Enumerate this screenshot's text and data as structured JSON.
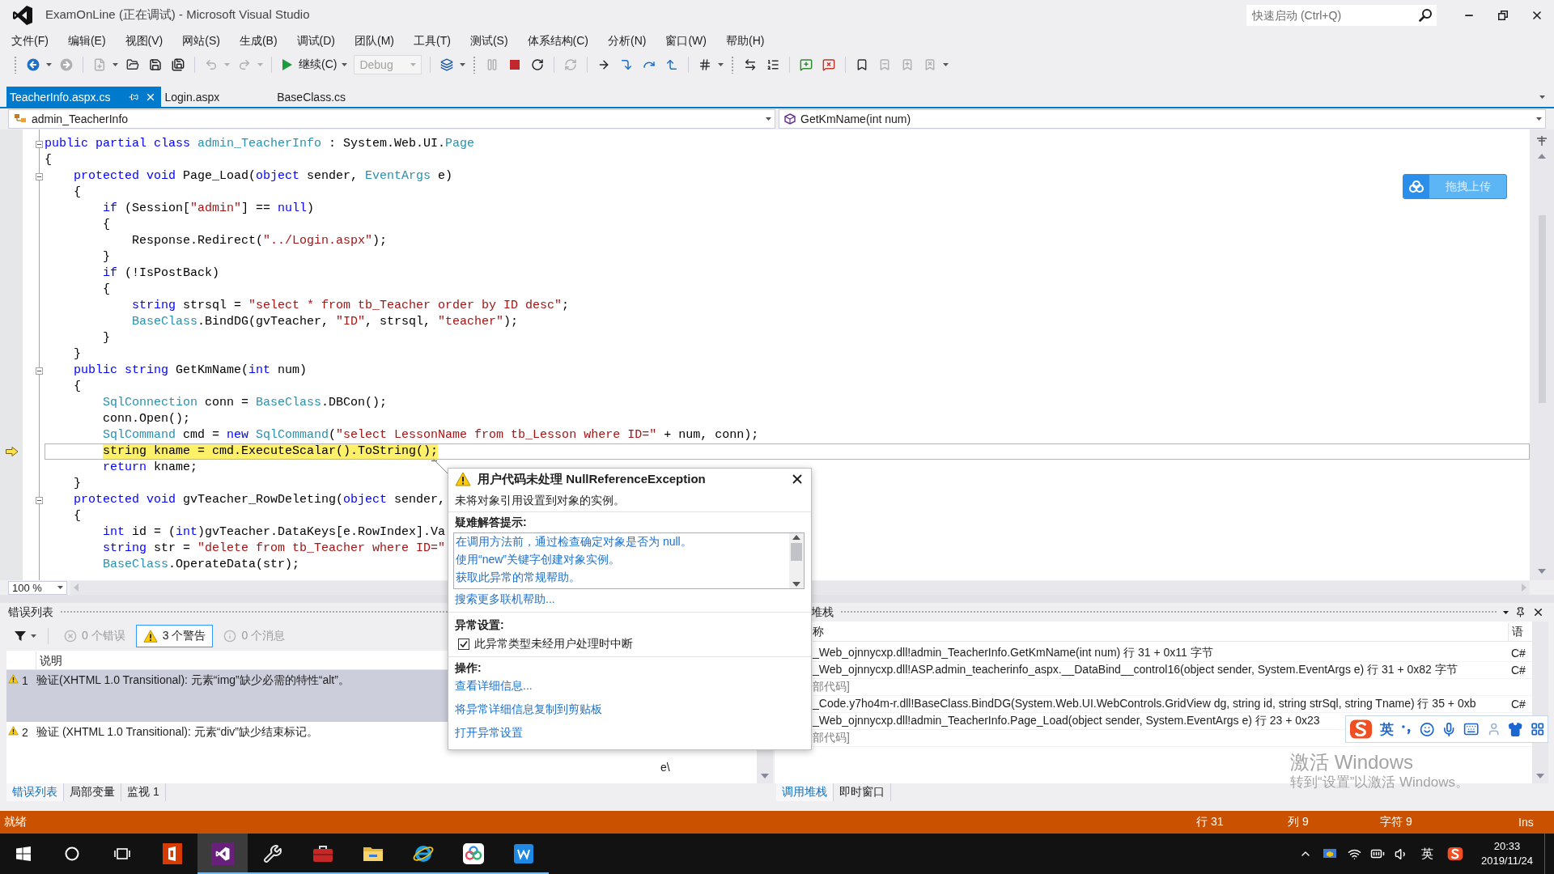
{
  "window": {
    "title": "ExamOnLine (正在调试) - Microsoft Visual Studio",
    "quick_launch": {
      "placeholder": "快速启动 (Ctrl+Q)"
    }
  },
  "menu": [
    "文件(F)",
    "编辑(E)",
    "视图(V)",
    "网站(S)",
    "生成(B)",
    "调试(D)",
    "团队(M)",
    "工具(T)",
    "测试(S)",
    "体系结构(C)",
    "分析(N)",
    "窗口(W)",
    "帮助(H)"
  ],
  "toolbar": [
    {
      "kind": "gripper"
    },
    {
      "kind": "back",
      "disabled": false
    },
    {
      "kind": "caret",
      "disabled": false
    },
    {
      "kind": "forward",
      "disabled": true
    },
    {
      "kind": "separator"
    },
    {
      "kind": "new_project",
      "disabled": true
    },
    {
      "kind": "caret",
      "disabled": false
    },
    {
      "kind": "open",
      "disabled": false
    },
    {
      "kind": "save",
      "disabled": false
    },
    {
      "kind": "save_all",
      "disabled": false
    },
    {
      "kind": "separator"
    },
    {
      "kind": "undo",
      "disabled": true
    },
    {
      "kind": "caret",
      "disabled": true
    },
    {
      "kind": "redo",
      "disabled": true
    },
    {
      "kind": "caret",
      "disabled": true
    },
    {
      "kind": "separator"
    },
    {
      "kind": "continue",
      "label": "继续(C)",
      "disabled": false
    },
    {
      "kind": "caret",
      "disabled": false
    },
    {
      "kind": "configuration",
      "value": "Debug",
      "disabled": true
    },
    {
      "kind": "separator"
    },
    {
      "kind": "attach",
      "disabled": false
    },
    {
      "kind": "caret",
      "disabled": false
    },
    {
      "kind": "gripper"
    },
    {
      "kind": "pause",
      "disabled": true
    },
    {
      "kind": "stop",
      "disabled": false
    },
    {
      "kind": "restart",
      "disabled": false
    },
    {
      "kind": "separator"
    },
    {
      "kind": "refresh",
      "disabled": true
    },
    {
      "kind": "separator"
    },
    {
      "kind": "show_next",
      "disabled": false
    },
    {
      "kind": "step_into",
      "disabled": false
    },
    {
      "kind": "step_over",
      "disabled": false
    },
    {
      "kind": "step_out",
      "disabled": false
    },
    {
      "kind": "separator"
    },
    {
      "kind": "hex",
      "disabled": false
    },
    {
      "kind": "caret",
      "disabled": false
    },
    {
      "kind": "gripper"
    },
    {
      "kind": "threads",
      "disabled": false
    },
    {
      "kind": "stack",
      "disabled": false
    },
    {
      "kind": "separator"
    },
    {
      "kind": "comment_add",
      "disabled": false
    },
    {
      "kind": "comment_remove",
      "disabled": false
    },
    {
      "kind": "separator"
    },
    {
      "kind": "bookmark",
      "disabled": false
    },
    {
      "kind": "bookmark_prev",
      "disabled": true
    },
    {
      "kind": "bookmark_next",
      "disabled": true
    },
    {
      "kind": "bookmark_clear",
      "disabled": true
    },
    {
      "kind": "caret",
      "disabled": false
    }
  ],
  "tabs": [
    {
      "label": "TeacherInfo.aspx.cs",
      "selected": true
    },
    {
      "label": "Login.aspx",
      "selected": false
    },
    {
      "label": "BaseClass.cs",
      "selected": false
    }
  ],
  "navigation": {
    "type": "admin_TeacherInfo",
    "member": "GetKmName(int num)"
  },
  "editor": {
    "zoom": "100 %",
    "lines": [
      {
        "expanded": true,
        "tokens": [
          {
            "kind": "keyword",
            "text": "public partial class "
          },
          {
            "kind": "type",
            "text": "admin_TeacherInfo"
          },
          {
            "kind": "plain",
            "text": " : System.Web.UI."
          },
          {
            "kind": "type",
            "text": "Page"
          }
        ]
      },
      {
        "tokens": [
          {
            "kind": "plain",
            "text": "{"
          }
        ],
        "children": [
          {
            "expanded": true,
            "tokens": [
              {
                "kind": "keyword",
                "text": "protected void"
              },
              {
                "kind": "plain",
                "text": " Page_Load("
              },
              {
                "kind": "keyword",
                "text": "object"
              },
              {
                "kind": "plain",
                "text": " sender, "
              },
              {
                "kind": "type",
                "text": "EventArgs"
              },
              {
                "kind": "plain",
                "text": " e)"
              }
            ]
          },
          {
            "tokens": [
              {
                "kind": "plain",
                "text": "{"
              }
            ],
            "children": [
              {
                "tokens": [
                  {
                    "kind": "keyword",
                    "text": "if"
                  },
                  {
                    "kind": "plain",
                    "text": " (Session["
                  },
                  {
                    "kind": "string",
                    "text": "\"admin\""
                  },
                  {
                    "kind": "plain",
                    "text": "] == "
                  },
                  {
                    "kind": "keyword",
                    "text": "null"
                  },
                  {
                    "kind": "plain",
                    "text": ")"
                  }
                ]
              },
              {
                "tokens": [
                  {
                    "kind": "plain",
                    "text": "{"
                  }
                ],
                "children": [
                  {
                    "tokens": [
                      {
                        "kind": "plain",
                        "text": "Response.Redirect("
                      },
                      {
                        "kind": "string",
                        "text": "\"../Login.aspx\""
                      },
                      {
                        "kind": "plain",
                        "text": ");"
                      }
                    ]
                  }
                ]
              },
              {
                "tokens": [
                  {
                    "kind": "plain",
                    "text": "}"
                  }
                ]
              },
              {
                "tokens": [
                  {
                    "kind": "keyword",
                    "text": "if"
                  },
                  {
                    "kind": "plain",
                    "text": " (!IsPostBack)"
                  }
                ]
              },
              {
                "tokens": [
                  {
                    "kind": "plain",
                    "text": "{"
                  }
                ],
                "children": [
                  {
                    "tokens": [
                      {
                        "kind": "keyword",
                        "text": "string"
                      },
                      {
                        "kind": "plain",
                        "text": " strsql = "
                      },
                      {
                        "kind": "string",
                        "text": "\"select * from tb_Teacher order by ID desc\""
                      },
                      {
                        "kind": "plain",
                        "text": ";"
                      }
                    ]
                  },
                  {
                    "tokens": [
                      {
                        "kind": "type",
                        "text": "BaseClass"
                      },
                      {
                        "kind": "plain",
                        "text": ".BindDG(gvTeacher, "
                      },
                      {
                        "kind": "string",
                        "text": "\"ID\""
                      },
                      {
                        "kind": "plain",
                        "text": ", strsql, "
                      },
                      {
                        "kind": "string",
                        "text": "\"teacher\""
                      },
                      {
                        "kind": "plain",
                        "text": ");"
                      }
                    ]
                  }
                ]
              },
              {
                "tokens": [
                  {
                    "kind": "plain",
                    "text": "}"
                  }
                ]
              }
            ]
          },
          {
            "tokens": [
              {
                "kind": "plain",
                "text": "}"
              }
            ]
          },
          {
            "expanded": true,
            "tokens": [
              {
                "kind": "keyword",
                "text": "public string"
              },
              {
                "kind": "plain",
                "text": " GetKmName("
              },
              {
                "kind": "keyword",
                "text": "int"
              },
              {
                "kind": "plain",
                "text": " num)"
              }
            ]
          },
          {
            "tokens": [
              {
                "kind": "plain",
                "text": "{"
              }
            ],
            "children": [
              {
                "tokens": [
                  {
                    "kind": "type",
                    "text": "SqlConnection"
                  },
                  {
                    "kind": "plain",
                    "text": " conn = "
                  },
                  {
                    "kind": "type",
                    "text": "BaseClass"
                  },
                  {
                    "kind": "plain",
                    "text": ".DBCon();"
                  }
                ]
              },
              {
                "tokens": [
                  {
                    "kind": "plain",
                    "text": "conn.Open();"
                  }
                ]
              },
              {
                "tokens": [
                  {
                    "kind": "type",
                    "text": "SqlCommand"
                  },
                  {
                    "kind": "plain",
                    "text": " cmd = "
                  },
                  {
                    "kind": "keyword",
                    "text": "new "
                  },
                  {
                    "kind": "type",
                    "text": "SqlCommand"
                  },
                  {
                    "kind": "plain",
                    "text": "("
                  },
                  {
                    "kind": "string",
                    "text": "\"select LessonName from tb_Lesson where ID=\""
                  },
                  {
                    "kind": "plain",
                    "text": " + num, conn);"
                  }
                ]
              },
              {
                "current": true,
                "tokens": [
                  {
                    "kind": "keyword",
                    "text": "string"
                  },
                  {
                    "kind": "plain",
                    "text": " kname = cmd.ExecuteScalar().ToString();"
                  }
                ]
              },
              {
                "tokens": [
                  {
                    "kind": "keyword",
                    "text": "return"
                  },
                  {
                    "kind": "plain",
                    "text": " kname;"
                  }
                ]
              }
            ]
          },
          {
            "tokens": [
              {
                "kind": "plain",
                "text": "}"
              }
            ]
          },
          {
            "expanded": true,
            "tokens": [
              {
                "kind": "keyword",
                "text": "protected void"
              },
              {
                "kind": "plain",
                "text": " gvTeacher_RowDeleting("
              },
              {
                "kind": "keyword",
                "text": "object"
              },
              {
                "kind": "plain",
                "text": " sender,"
              }
            ]
          },
          {
            "tokens": [
              {
                "kind": "plain",
                "text": "{"
              }
            ],
            "children": [
              {
                "tokens": [
                  {
                    "kind": "keyword",
                    "text": "int"
                  },
                  {
                    "kind": "plain",
                    "text": " id = ("
                  },
                  {
                    "kind": "keyword",
                    "text": "int"
                  },
                  {
                    "kind": "plain",
                    "text": ")gvTeacher.DataKeys[e.RowIndex].Va"
                  }
                ]
              },
              {
                "tokens": [
                  {
                    "kind": "keyword",
                    "text": "string"
                  },
                  {
                    "kind": "plain",
                    "text": " str = "
                  },
                  {
                    "kind": "string",
                    "text": "\"delete from tb_Teacher where ID=\""
                  }
                ]
              },
              {
                "tokens": [
                  {
                    "kind": "type",
                    "text": "BaseClass"
                  },
                  {
                    "kind": "plain",
                    "text": ".OperateData(str);"
                  }
                ]
              }
            ]
          }
        ]
      }
    ]
  },
  "upload_button": {
    "label": "拖拽上传"
  },
  "exception_popup": {
    "title": "用户代码未处理 NullReferenceException",
    "message": "未将对象引用设置到对象的实例。",
    "tips_heading": "疑难解答提示:",
    "tips": [
      "在调用方法前，通过检查确定对象是否为 null。",
      "使用“new”关键字创建对象实例。",
      "获取此异常的常规帮助。"
    ],
    "search_link": "搜索更多联机帮助...",
    "settings_heading": "异常设置:",
    "break_option": {
      "label": "此异常类型未经用户处理时中断",
      "checked": true
    },
    "actions_heading": "操作:",
    "actions": [
      "查看详细信息...",
      "将异常详细信息复制到剪贴板",
      "打开异常设置"
    ]
  },
  "error_list": {
    "title": "错误列表",
    "filters": [
      {
        "kind": "error",
        "label": "0 个错误",
        "selected": false
      },
      {
        "kind": "warning",
        "label": "3 个警告",
        "selected": true
      },
      {
        "kind": "message",
        "label": "0 个消息",
        "selected": false
      }
    ],
    "columns": [
      "说明"
    ],
    "rows": [
      {
        "number": "1",
        "description": "验证(XHTML 1.0 Transitional): 元素“img”缺少必需的特性“alt”。",
        "selected": true
      },
      {
        "number": "2",
        "description": "验证 (XHTML 1.0 Transitional): 元素“div”缺少结束标记。",
        "location": "e\\",
        "selected": false
      }
    ],
    "tabs": [
      {
        "label": "错误列表",
        "selected": true
      },
      {
        "label": "局部变量",
        "selected": false
      },
      {
        "label": "监视 1",
        "selected": false
      }
    ]
  },
  "call_stack": {
    "title": "堆栈",
    "columns": [
      "称",
      "语"
    ],
    "rows": [
      {
        "kind": "frame",
        "name": "_Web_ojnnycxp.dll!admin_TeacherInfo.GetKmName(int num) 行 31 + 0x11 字节",
        "language": "C#"
      },
      {
        "kind": "frame",
        "name": "_Web_ojnnycxp.dll!ASP.admin_teacherinfo_aspx.__DataBind__control16(object sender, System.EventArgs e) 行 31 + 0x82 字节",
        "language": "C#"
      },
      {
        "kind": "external",
        "name": "部代码]"
      },
      {
        "kind": "frame",
        "name": "_Code.y7ho4m-r.dll!BaseClass.BindDG(System.Web.UI.WebControls.GridView dg, string id, string strSql, string Tname) 行 35 + 0xb",
        "language": "C#"
      },
      {
        "kind": "frame",
        "name": "_Web_ojnnycxp.dll!admin_TeacherInfo.Page_Load(object sender, System.EventArgs e) 行 23 + 0x23"
      },
      {
        "kind": "external",
        "name": "部代码]"
      }
    ],
    "tabs": [
      {
        "label": "调用堆栈",
        "selected": true
      },
      {
        "label": "即时窗口",
        "selected": false
      }
    ]
  },
  "ime_toolbar": {
    "mode": "英"
  },
  "activation_notice": {
    "title": "激活 Windows",
    "text": "转到“设置”以激活 Windows。"
  },
  "status_bar": {
    "state": "就绪",
    "line": "行 31",
    "column": "列 9",
    "character": "字符 9",
    "mode": "Ins"
  },
  "taskbar": {
    "apps": [
      {
        "kind": "office",
        "running": false,
        "selected": false
      },
      {
        "kind": "visual_studio",
        "running": true,
        "selected": true
      },
      {
        "kind": "tools",
        "running": true,
        "selected": false
      },
      {
        "kind": "toolbox",
        "running": true,
        "selected": false
      },
      {
        "kind": "explorer",
        "running": true,
        "selected": false
      },
      {
        "kind": "browser",
        "running": true,
        "selected": false
      },
      {
        "kind": "cloud",
        "running": true,
        "selected": false
      },
      {
        "kind": "app",
        "running": true,
        "selected": false
      }
    ],
    "tray": {
      "input_mode": "英",
      "time": "20:33",
      "date": "2019/11/24"
    }
  }
}
